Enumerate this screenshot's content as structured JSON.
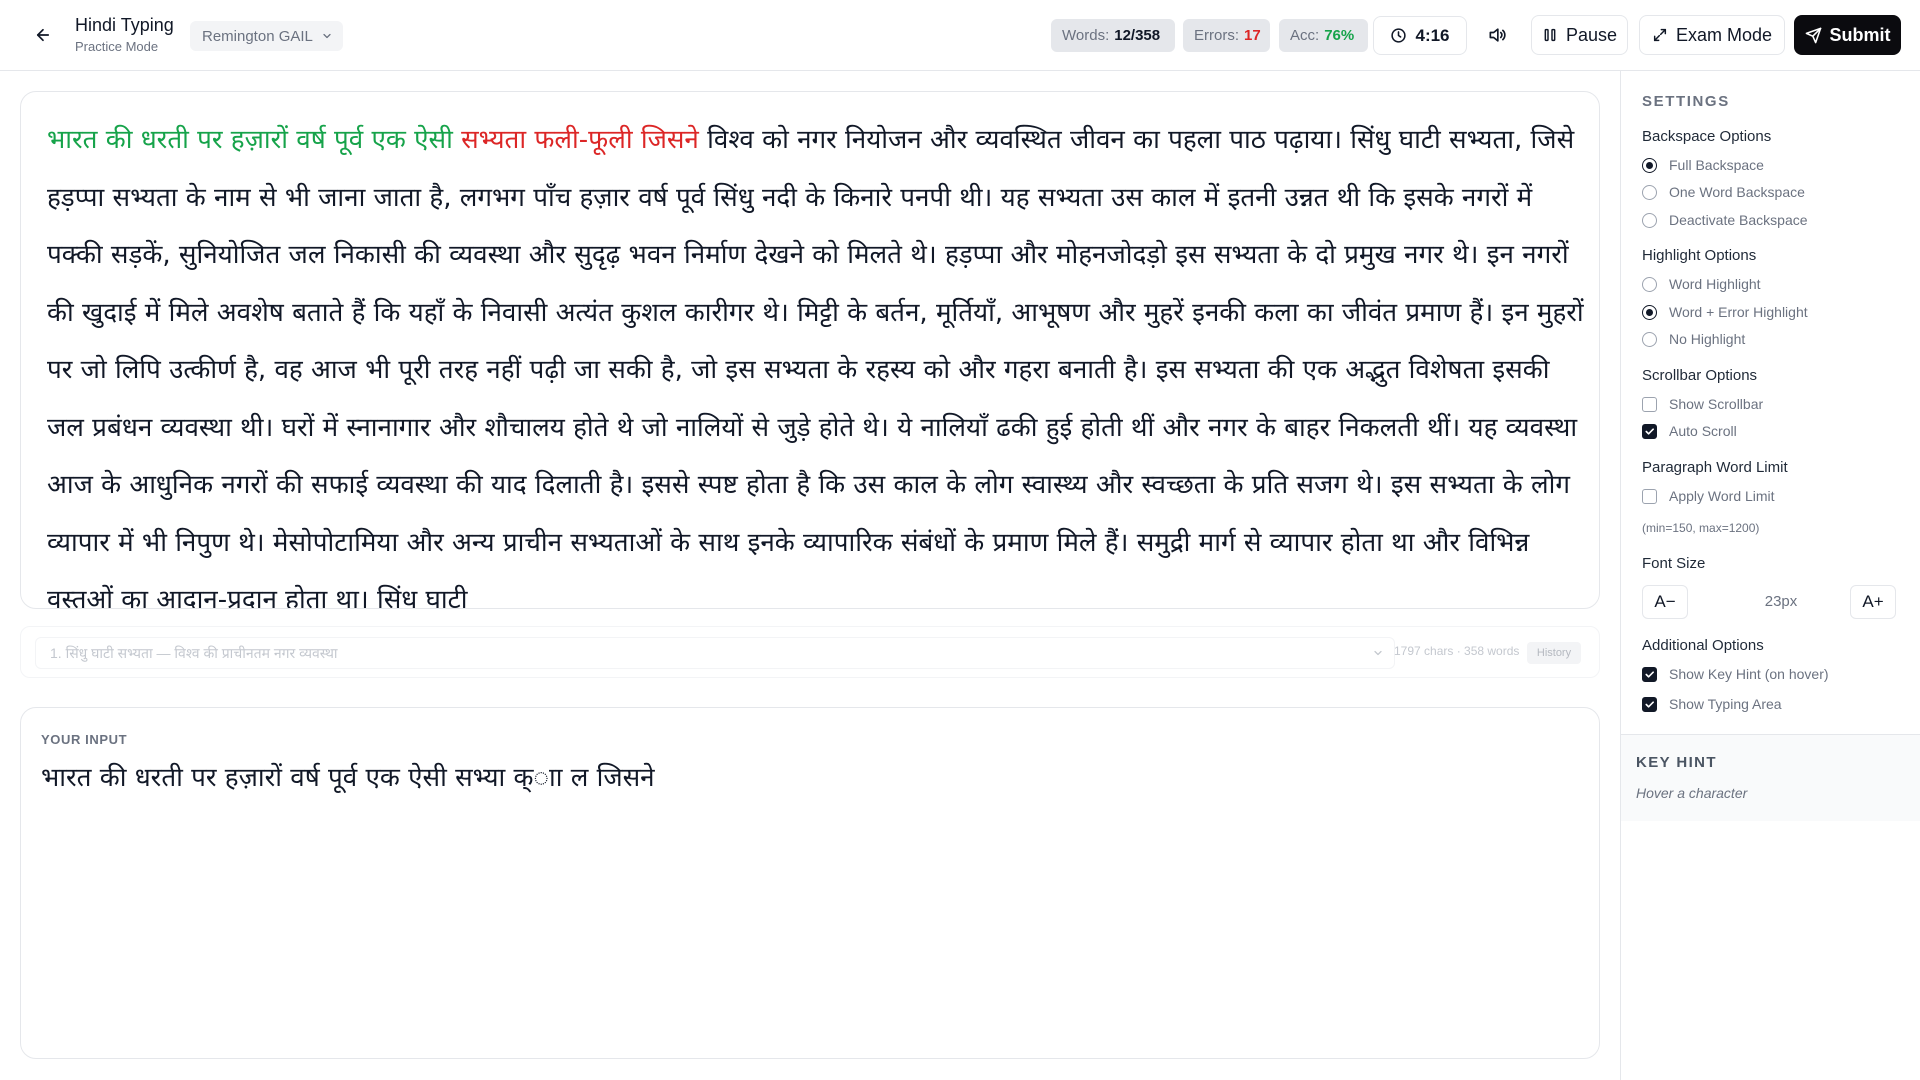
{
  "header": {
    "title": "Hindi Typing",
    "subtitle": "Practice Mode",
    "layout": "Remington GAIL",
    "words_label": "Words:",
    "words_value": "12/358",
    "errors_label": "Errors:",
    "errors_value": "17",
    "acc_label": "Acc:",
    "acc_value": "76%",
    "timer": "4:16",
    "pause_label": "Pause",
    "exam_label": "Exam Mode",
    "submit_label": "Submit"
  },
  "passage": {
    "typed_correct": "भारत की धरती पर हज़ारों वर्ष पूर्व एक ऐसी ",
    "typed_error": "सभ्यता फली-फूली जिसने",
    "remaining": " विश्व को नगर नियोजन और व्यवस्थित जीवन का पहला पाठ पढ़ाया। सिंधु घाटी सभ्यता, जिसे हड़प्पा सभ्यता के नाम से भी जाना जाता है, लगभग पाँच हज़ार वर्ष पूर्व सिंधु नदी के किनारे पनपी थी। यह सभ्यता उस काल में इतनी उन्नत थी कि इसके नगरों में पक्की सड़कें, सुनियोजित जल निकासी की व्यवस्था और सुदृढ़ भवन निर्माण देखने को मिलते थे। हड़प्पा और मोहनजोदड़ो इस सभ्यता के दो प्रमुख नगर थे। इन नगरों की खुदाई में मिले अवशेष बताते हैं कि यहाँ के निवासी अत्यंत कुशल कारीगर थे। मिट्टी के बर्तन, मूर्तियाँ, आभूषण और मुहरें इनकी कला का जीवंत प्रमाण हैं। इन मुहरों पर जो लिपि उत्कीर्ण है, वह आज भी पूरी तरह नहीं पढ़ी जा सकी है, जो इस सभ्यता के रहस्य को और गहरा बनाती है। इस सभ्यता की एक अद्भुत विशेषता इसकी जल प्रबंधन व्यवस्था थी। घरों में स्नानागार और शौचालय होते थे जो नालियों से जुड़े होते थे। ये नालियाँ ढकी हुई होती थीं और नगर के बाहर निकलती थीं। यह व्यवस्था आज के आधुनिक नगरों की सफाई व्यवस्था की याद दिलाती है। इससे स्पष्ट होता है कि उस काल के लोग स्वास्थ्य और स्वच्छता के प्रति सजग थे। इस सभ्यता के लोग व्यापार में भी निपुण थे। मेसोपोटामिया और अन्य प्राचीन सभ्यताओं के साथ इनके व्यापारिक संबंधों के प्रमाण मिले हैं। समुद्री मार्ग से व्यापार होता था और विभिन्न वस्तुओं का आदान-प्रदान होता था। सिंधु घाटी"
  },
  "passage_selector": {
    "selected": "1. सिंधु घाटी सभ्यता — विश्व की प्राचीनतम नगर व्यवस्था",
    "meta": "1797 chars · 358 words",
    "history_label": "History"
  },
  "input": {
    "label": "YOUR INPUT",
    "value": "भारत की धरती पर हज़ारों वर्ष पूर्व एक ऐसी सभ्या क्ाा  ल जिसने"
  },
  "sidebar": {
    "title": "SETTINGS",
    "backspace": {
      "title": "Backspace Options",
      "options": [
        "Full Backspace",
        "One Word Backspace",
        "Deactivate Backspace"
      ],
      "selected": 0
    },
    "highlight": {
      "title": "Highlight Options",
      "options": [
        "Word Highlight",
        "Word + Error Highlight",
        "No Highlight"
      ],
      "selected": 1
    },
    "scrollbar": {
      "title": "Scrollbar Options",
      "options": [
        "Show Scrollbar",
        "Auto Scroll"
      ],
      "checked": [
        false,
        true
      ]
    },
    "word_limit": {
      "title": "Paragraph Word Limit",
      "option": "Apply Word Limit",
      "checked": false,
      "hint": "(min=150, max=1200)"
    },
    "font_size": {
      "title": "Font Size",
      "decrease": "A−",
      "value": "23px",
      "increase": "A+"
    },
    "additional": {
      "title": "Additional Options",
      "options": [
        "Show Key Hint (on hover)",
        "Show Typing Area"
      ],
      "checked": [
        true,
        true
      ]
    },
    "key_hint": {
      "title": "KEY HINT",
      "text": "Hover a character"
    }
  }
}
